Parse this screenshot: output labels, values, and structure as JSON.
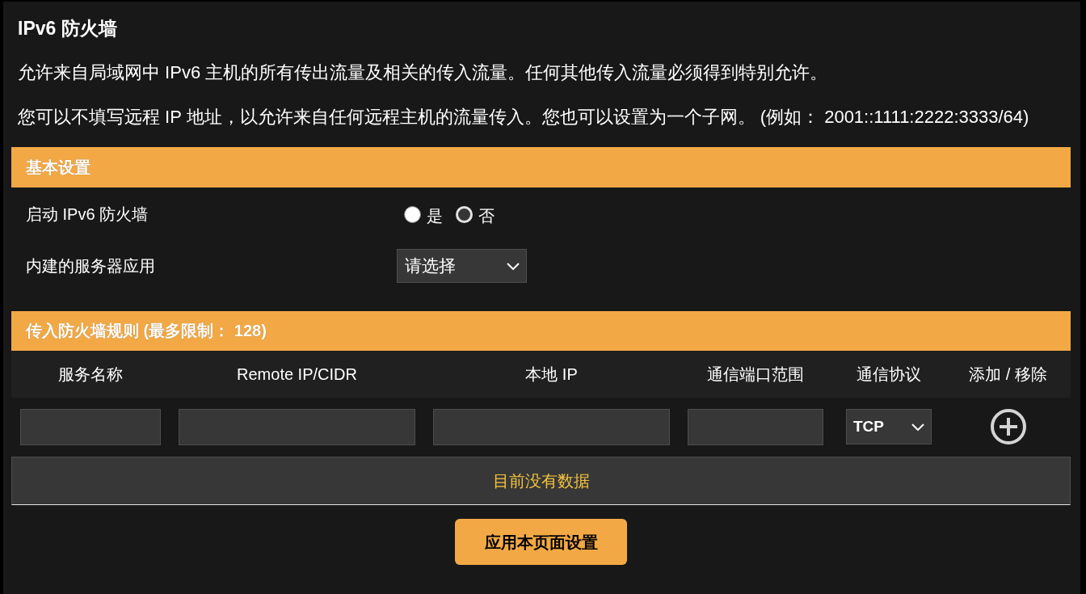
{
  "title": "IPv6 防火墙",
  "description": [
    "允许来自局域网中 IPv6 主机的所有传出流量及相关的传入流量。任何其他传入流量必须得到特别允许。",
    "您可以不填写远程 IP 地址，以允许来自任何远程主机的流量传入。您也可以设置为一个子网。 (例如： 2001::1111:2222:3333/64)"
  ],
  "basic_settings": {
    "header": "基本设置",
    "fields": [
      {
        "kind": "radio",
        "label": "启动 IPv6 防火墙",
        "options": [
          {
            "label": "是",
            "selected": false
          },
          {
            "label": "否",
            "selected": true
          }
        ]
      },
      {
        "kind": "select",
        "label": "内建的服务器应用",
        "value": "请选择"
      }
    ]
  },
  "rules": {
    "header": "传入防火墙规则 (最多限制： 128)",
    "columns": [
      "服务名称",
      "Remote IP/CIDR",
      "本地 IP",
      "通信端口范围",
      "通信协议",
      "添加 / 移除"
    ],
    "new_rule": [
      {
        "kind": "input"
      },
      {
        "kind": "input"
      },
      {
        "kind": "input"
      },
      {
        "kind": "input"
      },
      {
        "kind": "select",
        "value": "TCP"
      },
      {
        "kind": "add"
      }
    ],
    "empty_message": "目前没有数据"
  },
  "apply_button": "应用本页面设置"
}
